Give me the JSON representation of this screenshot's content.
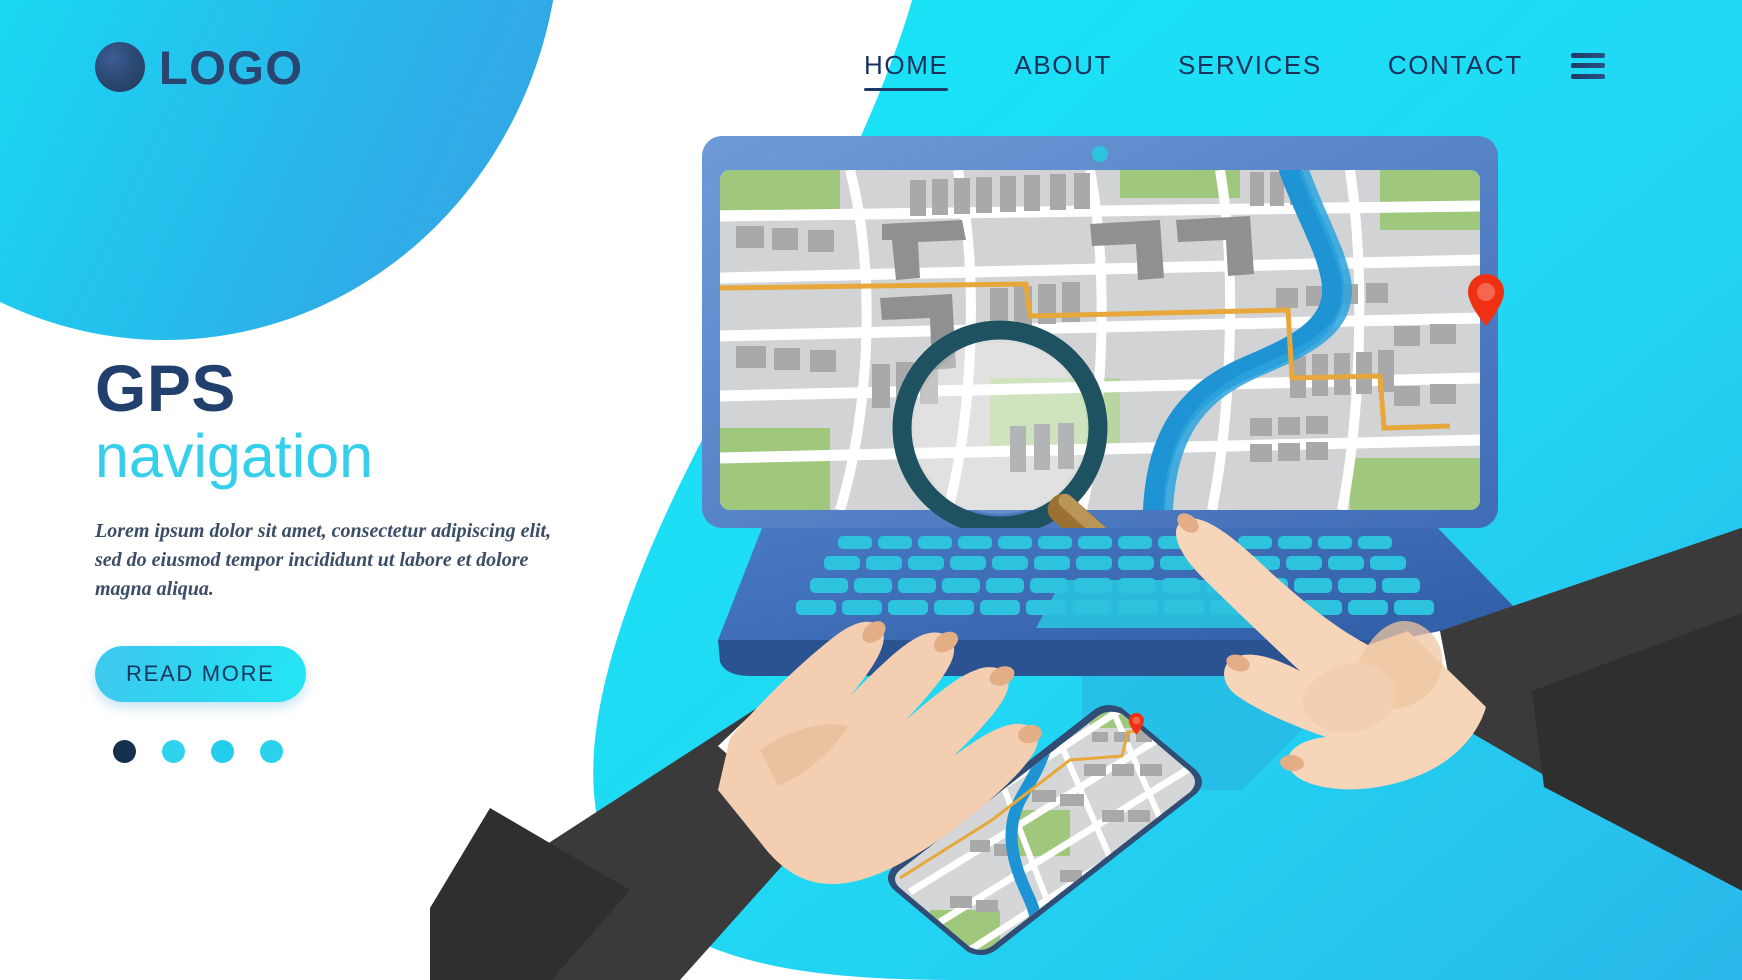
{
  "brand": {
    "logo_text": "LOGO",
    "logo_icon": "circle-logo-icon"
  },
  "nav": {
    "items": [
      {
        "label": "HOME",
        "active": true
      },
      {
        "label": "ABOUT",
        "active": false
      },
      {
        "label": "SERVICES",
        "active": false
      },
      {
        "label": "CONTACT",
        "active": false
      }
    ],
    "menu_icon": "hamburger-menu-icon"
  },
  "hero": {
    "title": "GPS",
    "subtitle": "navigation",
    "paragraph": "Lorem ipsum dolor sit amet, consectetur adipiscing elit, sed do eiusmod tempor incididunt ut labore et dolore magna aliqua.",
    "cta_label": "READ MORE",
    "carousel_dots": [
      {
        "color": "#14304f",
        "active": true
      },
      {
        "color": "#2fd3ee",
        "active": false
      },
      {
        "color": "#23cdec",
        "active": false
      },
      {
        "color": "#2ad2ee",
        "active": false
      }
    ]
  },
  "illustration": {
    "laptop": {
      "name": "laptop-with-map",
      "camera_icon": "webcam-icon",
      "screen_content": "city-street-map"
    },
    "phone": {
      "name": "smartphone-with-map",
      "screen_content": "city-street-map"
    },
    "magnifier": {
      "name": "magnifying-glass-icon"
    },
    "map_pin": {
      "name": "map-pin-icon",
      "color": "#f03013"
    },
    "hand_left": {
      "name": "left-hand-on-keyboard"
    },
    "hand_right": {
      "name": "right-hand-holding-magnifier"
    }
  },
  "colors": {
    "cyan": "#16e4f7",
    "sky": "#2fbde8",
    "navy": "#22406e",
    "accent": "#36cfeb",
    "laptop_body": "#4f7fc4",
    "keyboard": "#2cc0dd",
    "route": "#efb13c",
    "river": "#1f94d4"
  }
}
